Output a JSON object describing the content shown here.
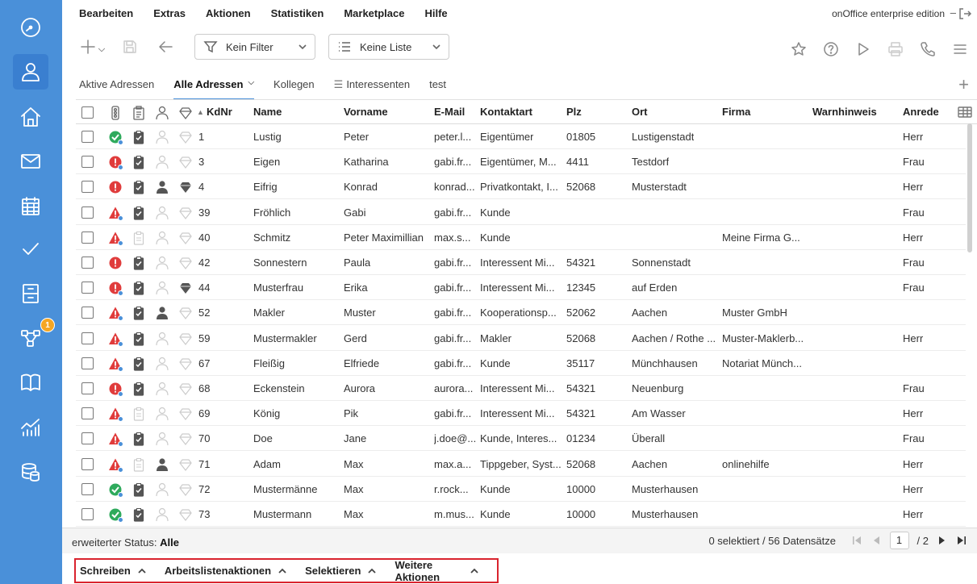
{
  "menu": [
    "Bearbeiten",
    "Extras",
    "Aktionen",
    "Statistiken",
    "Marketplace",
    "Hilfe"
  ],
  "edition": "onOffice enterprise edition",
  "edition_min": "–",
  "toolbar": {
    "filter_label": "Kein Filter",
    "list_label": "Keine Liste"
  },
  "tabs": [
    {
      "label": "Aktive Adressen"
    },
    {
      "label": "Alle Adressen"
    },
    {
      "label": "Kollegen"
    },
    {
      "label": "Interessenten"
    },
    {
      "label": "test"
    }
  ],
  "sidebar_badge": "1",
  "columns": {
    "kdnr": "KdNr",
    "name": "Name",
    "vorname": "Vorname",
    "email": "E-Mail",
    "kontaktart": "Kontaktart",
    "plz": "Plz",
    "ort": "Ort",
    "firma": "Firma",
    "warnhinweis": "Warnhinweis",
    "anrede": "Anrede"
  },
  "rows": [
    {
      "status": "ok",
      "board": true,
      "person": false,
      "diamond": false,
      "kdnr": "1",
      "name": "Lustig",
      "vorname": "Peter",
      "email": "peter.l...",
      "kontaktart": "Eigentümer",
      "plz": "01805",
      "ort": "Lustigenstadt",
      "firma": "",
      "anrede": "Herr"
    },
    {
      "status": "error",
      "board": true,
      "person": false,
      "diamond": false,
      "kdnr": "3",
      "name": "Eigen",
      "vorname": "Katharina",
      "email": "gabi.fr...",
      "kontaktart": "Eigentümer, M...",
      "plz": "4411",
      "ort": "Testdorf",
      "firma": "",
      "anrede": "Frau"
    },
    {
      "status": "error-plain",
      "board": true,
      "person": true,
      "diamond": true,
      "kdnr": "4",
      "name": "Eifrig",
      "vorname": "Konrad",
      "email": "konrad...",
      "kontaktart": "Privatkontakt, I...",
      "plz": "52068",
      "ort": "Musterstadt",
      "firma": "",
      "anrede": "Herr"
    },
    {
      "status": "warn",
      "board": true,
      "person": false,
      "diamond": false,
      "kdnr": "39",
      "name": "Fröhlich",
      "vorname": "Gabi",
      "email": "gabi.fr...",
      "kontaktart": "Kunde",
      "plz": "",
      "ort": "",
      "firma": "",
      "anrede": "Frau"
    },
    {
      "status": "warn",
      "board": false,
      "person": false,
      "diamond": false,
      "kdnr": "40",
      "name": "Schmitz",
      "vorname": "Peter Maximillian",
      "email": "max.s...",
      "kontaktart": "Kunde",
      "plz": "",
      "ort": "",
      "firma": "Meine Firma G...",
      "anrede": "Herr"
    },
    {
      "status": "error-plain",
      "board": true,
      "person": false,
      "diamond": false,
      "kdnr": "42",
      "name": "Sonnestern",
      "vorname": "Paula",
      "email": "gabi.fr...",
      "kontaktart": "Interessent Mi...",
      "plz": "54321",
      "ort": "Sonnenstadt",
      "firma": "",
      "anrede": "Frau"
    },
    {
      "status": "error",
      "board": true,
      "person": false,
      "diamond": true,
      "kdnr": "44",
      "name": "Musterfrau",
      "vorname": "Erika",
      "email": "gabi.fr...",
      "kontaktart": "Interessent Mi...",
      "plz": "12345",
      "ort": "auf Erden",
      "firma": "",
      "anrede": "Frau"
    },
    {
      "status": "warn",
      "board": true,
      "person": true,
      "diamond": false,
      "kdnr": "52",
      "name": "Makler",
      "vorname": "Muster",
      "email": "gabi.fr...",
      "kontaktart": "Kooperationsp...",
      "plz": "52062",
      "ort": "Aachen",
      "firma": "Muster GmbH",
      "anrede": ""
    },
    {
      "status": "warn",
      "board": true,
      "person": false,
      "diamond": false,
      "kdnr": "59",
      "name": "Mustermakler",
      "vorname": "Gerd",
      "email": "gabi.fr...",
      "kontaktart": "Makler",
      "plz": "52068",
      "ort": "Aachen / Rothe ...",
      "firma": "Muster-Maklerb...",
      "anrede": "Herr"
    },
    {
      "status": "warn",
      "board": true,
      "person": false,
      "diamond": false,
      "kdnr": "67",
      "name": "Fleißig",
      "vorname": "Elfriede",
      "email": "gabi.fr...",
      "kontaktart": "Kunde",
      "plz": "35117",
      "ort": "Münchhausen",
      "firma": "Notariat Münch...",
      "anrede": ""
    },
    {
      "status": "error",
      "board": true,
      "person": false,
      "diamond": false,
      "kdnr": "68",
      "name": "Eckenstein",
      "vorname": "Aurora",
      "email": "aurora...",
      "kontaktart": "Interessent Mi...",
      "plz": "54321",
      "ort": "Neuenburg",
      "firma": "",
      "anrede": "Frau"
    },
    {
      "status": "warn",
      "board": false,
      "person": false,
      "diamond": false,
      "kdnr": "69",
      "name": "König",
      "vorname": "Pik",
      "email": "gabi.fr...",
      "kontaktart": "Interessent Mi...",
      "plz": "54321",
      "ort": "Am Wasser",
      "firma": "",
      "anrede": "Herr"
    },
    {
      "status": "warn",
      "board": true,
      "person": false,
      "diamond": false,
      "kdnr": "70",
      "name": "Doe",
      "vorname": "Jane",
      "email": "j.doe@...",
      "kontaktart": "Kunde, Interes...",
      "plz": "01234",
      "ort": "Überall",
      "firma": "",
      "anrede": "Frau"
    },
    {
      "status": "warn",
      "board": false,
      "person": true,
      "diamond": false,
      "kdnr": "71",
      "name": "Adam",
      "vorname": "Max",
      "email": "max.a...",
      "kontaktart": "Tippgeber, Syst...",
      "plz": "52068",
      "ort": "Aachen",
      "firma": "onlinehilfe",
      "anrede": "Herr"
    },
    {
      "status": "ok",
      "board": true,
      "person": false,
      "diamond": false,
      "kdnr": "72",
      "name": "Mustermänne",
      "vorname": "Max",
      "email": "r.rock...",
      "kontaktart": "Kunde",
      "plz": "10000",
      "ort": "Musterhausen",
      "firma": "",
      "anrede": "Herr"
    },
    {
      "status": "ok",
      "board": true,
      "person": false,
      "diamond": false,
      "kdnr": "73",
      "name": "Mustermann",
      "vorname": "Max",
      "email": "m.mus...",
      "kontaktart": "Kunde",
      "plz": "10000",
      "ort": "Musterhausen",
      "firma": "",
      "anrede": "Herr"
    }
  ],
  "statusbar": {
    "label": "erweiterter Status:",
    "value": "Alle",
    "selection": "0 selektiert / 56 Datensätze",
    "page": "1",
    "total": "/ 2"
  },
  "actions": [
    "Schreiben",
    "Arbeitslistenaktionen",
    "Selektieren",
    "Weitere Aktionen"
  ],
  "colors": {
    "sidebar": "#4a90d9",
    "ok": "#2eaa5c",
    "error": "#e03c3c",
    "highlight_border": "#d9232e"
  }
}
